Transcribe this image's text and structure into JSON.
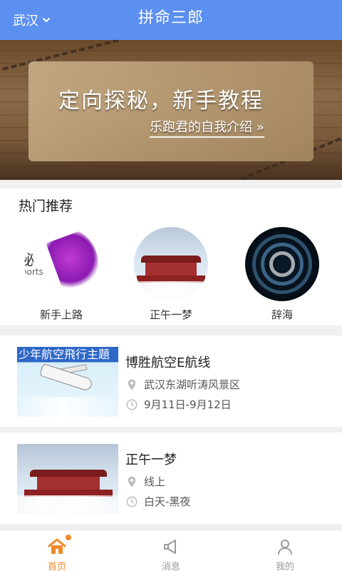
{
  "header": {
    "city": "武汉",
    "title": "拼命三郎"
  },
  "banner": {
    "headline": "定向探秘，新手教程",
    "subline": "乐跑君的自我介绍 »"
  },
  "hot": {
    "title": "热门推荐",
    "items": [
      {
        "label": "新手上路",
        "thumb_text": "秘",
        "thumb_subtext": "ports"
      },
      {
        "label": "正午一梦"
      },
      {
        "label": "辞海"
      }
    ]
  },
  "cards": [
    {
      "title": "博胜航空E航线",
      "location": "武汉东湖听涛风景区",
      "time": "9月11日-9月12日",
      "thumb_text": "少年航空飛行主題"
    },
    {
      "title": "正午一梦",
      "location": "线上",
      "time": "白天-黑夜"
    }
  ],
  "tabs": [
    {
      "label": "首页",
      "active": true
    },
    {
      "label": "消息",
      "active": false
    },
    {
      "label": "我的",
      "active": false
    }
  ],
  "colors": {
    "header": "#5b8ff0",
    "active_tab": "#f08a2a"
  }
}
